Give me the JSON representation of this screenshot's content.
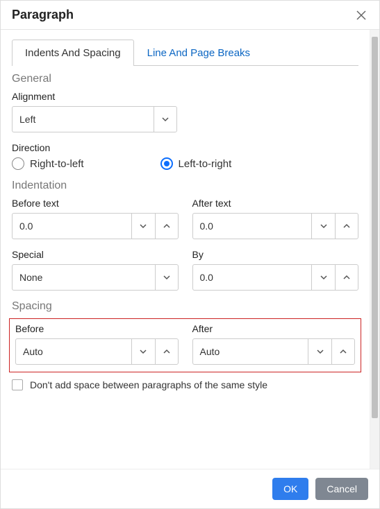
{
  "dialog": {
    "title": "Paragraph"
  },
  "tabs": {
    "indents": "Indents And Spacing",
    "breaks": "Line And Page Breaks"
  },
  "general": {
    "heading": "General",
    "alignment_label": "Alignment",
    "alignment_value": "Left",
    "direction_label": "Direction",
    "rtl_label": "Right-to-left",
    "ltr_label": "Left-to-right"
  },
  "indentation": {
    "heading": "Indentation",
    "before_text_label": "Before text",
    "before_text_value": "0.0",
    "after_text_label": "After text",
    "after_text_value": "0.0",
    "special_label": "Special",
    "special_value": "None",
    "by_label": "By",
    "by_value": "0.0"
  },
  "spacing": {
    "heading": "Spacing",
    "before_label": "Before",
    "before_value": "Auto",
    "after_label": "After",
    "after_value": "Auto",
    "same_style_label": "Don't add space between paragraphs of the same style"
  },
  "footer": {
    "ok": "OK",
    "cancel": "Cancel"
  }
}
